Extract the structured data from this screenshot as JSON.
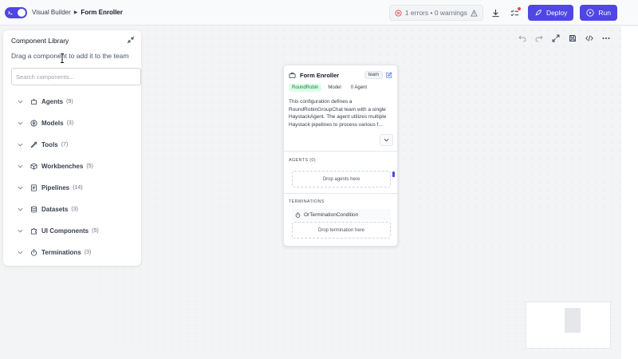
{
  "header": {
    "breadcrumb_root": "Visual Builder",
    "breadcrumb_current": "Form Enroller",
    "validation_text": "1 errors • 0 warnings",
    "deploy_label": "Deploy",
    "run_label": "Run",
    "accent_color": "#4f46e5",
    "error_color": "#ef4444"
  },
  "library": {
    "title": "Component Library",
    "subtitle": "Drag a component to add it to the team",
    "search_placeholder": "Search components...",
    "items": [
      {
        "label": "Agents",
        "count": "(9)",
        "icon": "bot-icon"
      },
      {
        "label": "Models",
        "count": "(3)",
        "icon": "brain-icon"
      },
      {
        "label": "Tools",
        "count": "(7)",
        "icon": "wrench-icon"
      },
      {
        "label": "Workbenches",
        "count": "(5)",
        "icon": "package-icon"
      },
      {
        "label": "Pipelines",
        "count": "(14)",
        "icon": "pipeline-icon"
      },
      {
        "label": "Datasets",
        "count": "(3)",
        "icon": "database-icon"
      },
      {
        "label": "UI Components",
        "count": "(5)",
        "icon": "puzzle-icon"
      },
      {
        "label": "Terminations",
        "count": "(3)",
        "icon": "timer-icon"
      }
    ]
  },
  "node": {
    "title": "Form Enroller",
    "type_tag": "team",
    "chips": [
      "RoundRobin",
      "Model",
      "0 Agent"
    ],
    "description": "This configuration defines a RoundRobinGroupChat team with a single HaystackAgent. The agent utilizes multiple Haystack pipelines to process various f...",
    "agents_label": "AGENTS (0)",
    "agents_drop": "Drop agents here",
    "terminations_label": "TERMINATIONS",
    "termination_item": "OrTerminationCondition",
    "termination_drop": "Drop termination here"
  }
}
